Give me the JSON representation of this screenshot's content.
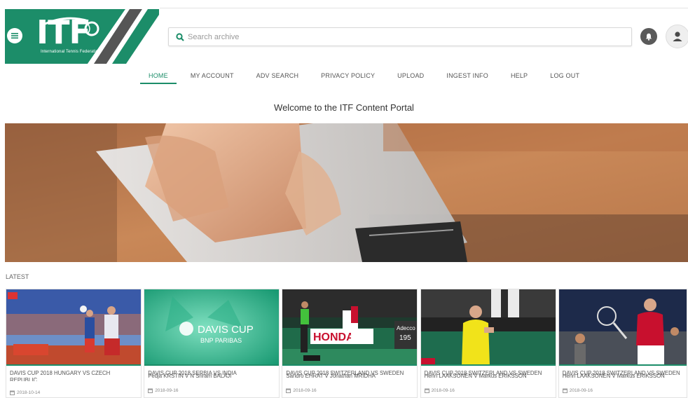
{
  "brand": {
    "logo_text": "ITF",
    "subtitle": "International Tennis Federation",
    "green": "#1c8d69"
  },
  "header": {
    "search_placeholder": "Search archive",
    "menu_icon": "menu-icon",
    "search_icon": "search-icon",
    "bell_icon": "bell-icon",
    "avatar_icon": "user-icon"
  },
  "nav": {
    "items": [
      {
        "label": "HOME",
        "active": true
      },
      {
        "label": "MY ACCOUNT"
      },
      {
        "label": "ADV SEARCH"
      },
      {
        "label": "PRIVACY POLICY"
      },
      {
        "label": "UPLOAD"
      },
      {
        "label": "INGEST INFO"
      },
      {
        "label": "HELP"
      },
      {
        "label": "LOG OUT"
      }
    ]
  },
  "welcome": "Welcome to the ITF Content Portal",
  "latest_label": "LATEST",
  "cards": [
    {
      "title": "DAVIS CUP 2018 HUNGARY VS CZECH REPUBLIC",
      "players": "",
      "date": "2018-10-14"
    },
    {
      "title": "DAVIS CUP 2018 SERBIA VS INDIA",
      "players": "Pedja KRSTIN V N Sriram BALAJI",
      "date": "2018-09-16"
    },
    {
      "title": "DAVIS CUP 2018 SWITZERLAND VS SWEDEN",
      "players": "Sandro EHRAT V Jonathan MRIDHA",
      "date": "2018-09-16"
    },
    {
      "title": "DAVIS CUP 2018 SWITZERLAND VS SWEDEN",
      "players": "Henri LAAKSONEN V Markus ERIKSSON",
      "date": "2018-09-16"
    },
    {
      "title": "DAVIS CUP 2018 SWITZERLAND VS SWEDEN",
      "players": "Henri LAAKSONEN V Markus ERIKSSON",
      "date": "2018-09-16"
    }
  ],
  "thumb_texts": {
    "davis_cup": "DAVIS CUP",
    "bnp": "BNP PARIBAS",
    "honda": "HONDA",
    "adecco": "Adecco",
    "score": "195"
  }
}
